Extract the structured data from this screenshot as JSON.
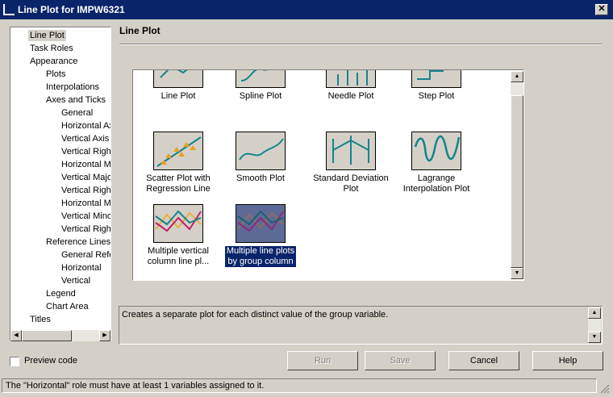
{
  "window": {
    "title": "Line Plot for IMPW6321",
    "close_glyph": "✕"
  },
  "nav": {
    "items": [
      {
        "label": "Line Plot",
        "level": 1,
        "selected": true
      },
      {
        "label": "Task Roles",
        "level": 1
      },
      {
        "label": "Appearance",
        "level": 1
      },
      {
        "label": "Plots",
        "level": 2
      },
      {
        "label": "Interpolations",
        "level": 2
      },
      {
        "label": "Axes and Ticks",
        "level": 2
      },
      {
        "label": "General",
        "level": 3
      },
      {
        "label": "Horizontal Ax",
        "level": 3
      },
      {
        "label": "Vertical Axis",
        "level": 3
      },
      {
        "label": "Vertical Right",
        "level": 3
      },
      {
        "label": "Horizontal Ma",
        "level": 3
      },
      {
        "label": "Vertical Majo",
        "level": 3
      },
      {
        "label": "Vertical Right",
        "level": 3
      },
      {
        "label": "Horizontal Mi",
        "level": 3
      },
      {
        "label": "Vertical Mino",
        "level": 3
      },
      {
        "label": "Vertical Right",
        "level": 3
      },
      {
        "label": "Reference Lines",
        "level": 2
      },
      {
        "label": "General Refe",
        "level": 3
      },
      {
        "label": "Horizontal",
        "level": 3
      },
      {
        "label": "Vertical",
        "level": 3
      },
      {
        "label": "Legend",
        "level": 2
      },
      {
        "label": "Chart Area",
        "level": 2
      },
      {
        "label": "Titles",
        "level": 1
      }
    ]
  },
  "panel": {
    "title": "Line Plot"
  },
  "plots": [
    {
      "label": "Line Plot",
      "icon": "line-plot-icon"
    },
    {
      "label": "Spline Plot",
      "icon": "spline-plot-icon"
    },
    {
      "label": "Needle Plot",
      "icon": "needle-plot-icon"
    },
    {
      "label": "Step Plot",
      "icon": "step-plot-icon"
    },
    {
      "label": "Scatter Plot with Regression Line",
      "icon": "scatter-regression-icon"
    },
    {
      "label": "Smooth Plot",
      "icon": "smooth-plot-icon"
    },
    {
      "label": "Standard Deviation Plot",
      "icon": "std-dev-plot-icon"
    },
    {
      "label": "Lagrange Interpolation Plot",
      "icon": "lagrange-plot-icon"
    },
    {
      "label": "Multiple vertical column line pl...",
      "icon": "multi-vertical-column-icon"
    },
    {
      "label": "Multiple line plots by group column",
      "icon": "multi-group-line-icon",
      "selected": true
    }
  ],
  "description": "Creates a separate plot for each distinct value of the group variable.",
  "preview_code_label": "Preview code",
  "buttons": {
    "run": "Run",
    "save": "Save",
    "cancel": "Cancel",
    "help": "Help"
  },
  "status": "The \"Horizontal\" role must have at least 1 variables assigned to it.",
  "colors": {
    "titlebar": "#0a246a",
    "plot_teal": "#14848a",
    "selection": "#0a246a",
    "face": "#d4d0c8"
  }
}
